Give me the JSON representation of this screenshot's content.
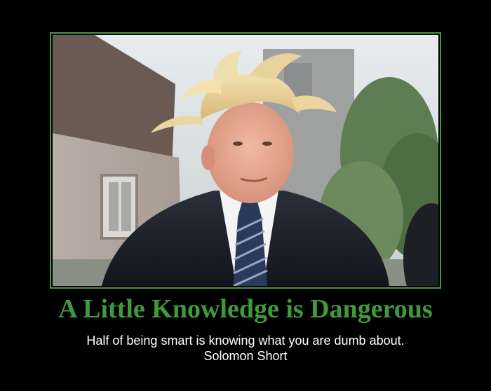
{
  "poster": {
    "title": "A Little Knowledge is Dangerous",
    "quote": "Half of being smart is knowing what you are dumb about.",
    "attribution": "Solomon Short"
  },
  "colors": {
    "background": "#000000",
    "frame": "#3f9a3b",
    "title": "#3f9a3b",
    "caption": "#ffffff"
  },
  "photo": {
    "subject": "man-with-windblown-hair-in-dark-suit-and-striped-tie"
  }
}
